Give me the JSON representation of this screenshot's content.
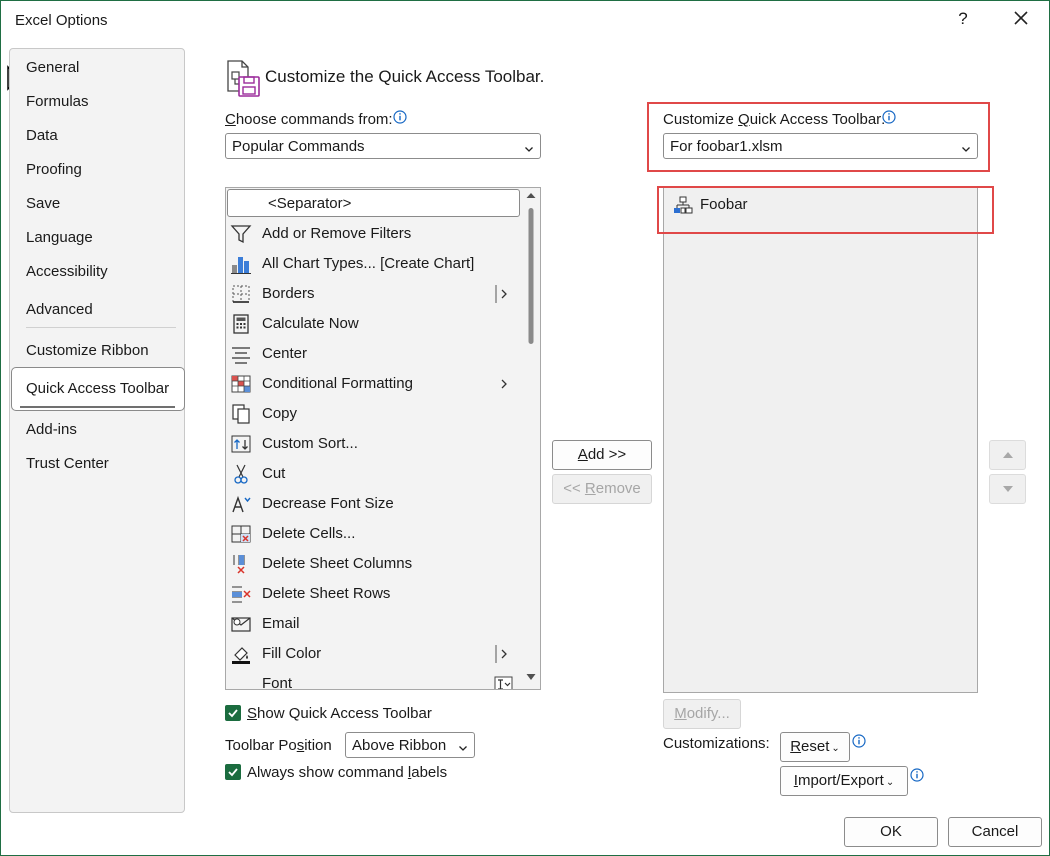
{
  "window": {
    "title": "Excel Options",
    "help_label": "?"
  },
  "sidebar": {
    "items": [
      {
        "label": "General"
      },
      {
        "label": "Formulas"
      },
      {
        "label": "Data"
      },
      {
        "label": "Proofing"
      },
      {
        "label": "Save"
      },
      {
        "label": "Language"
      },
      {
        "label": "Accessibility"
      },
      {
        "label": "Advanced"
      },
      {
        "label": "Customize Ribbon"
      },
      {
        "label": "Quick Access Toolbar"
      },
      {
        "label": "Add-ins"
      },
      {
        "label": "Trust Center"
      }
    ],
    "selected": "Quick Access Toolbar"
  },
  "header": {
    "title": "Customize the Quick Access Toolbar."
  },
  "choose_commands": {
    "label_mnemonic": "C",
    "label_rest": "hoose commands from:",
    "selected": "Popular Commands"
  },
  "commands": {
    "separator_label": "<Separator>",
    "items": [
      {
        "label": "Add or Remove Filters",
        "icon": "filter-icon"
      },
      {
        "label": "All Chart Types... [Create Chart]",
        "icon": "chart-icon"
      },
      {
        "label": "Borders",
        "icon": "borders-icon",
        "submenu": "split"
      },
      {
        "label": "Calculate Now",
        "icon": "calculator-icon"
      },
      {
        "label": "Center",
        "icon": "center-align-icon"
      },
      {
        "label": "Conditional Formatting",
        "icon": "conditional-formatting-icon",
        "submenu": "arrow"
      },
      {
        "label": "Copy",
        "icon": "copy-icon"
      },
      {
        "label": "Custom Sort...",
        "icon": "sort-icon"
      },
      {
        "label": "Cut",
        "icon": "scissors-icon"
      },
      {
        "label": "Decrease Font Size",
        "icon": "decrease-font-icon"
      },
      {
        "label": "Delete Cells...",
        "icon": "delete-cells-icon"
      },
      {
        "label": "Delete Sheet Columns",
        "icon": "delete-columns-icon"
      },
      {
        "label": "Delete Sheet Rows",
        "icon": "delete-rows-icon"
      },
      {
        "label": "Email",
        "icon": "email-icon"
      },
      {
        "label": "Fill Color",
        "icon": "fill-color-icon",
        "submenu": "split"
      },
      {
        "label": "Font",
        "icon": "font-icon",
        "submenu": "combo"
      }
    ]
  },
  "show_qat": {
    "mnemonic": "S",
    "rest": "how Quick Access Toolbar",
    "checked": true
  },
  "toolbar_position": {
    "label_pre": "Toolbar Po",
    "label_mnemonic": "s",
    "label_post": "ition",
    "selected": "Above Ribbon"
  },
  "always_show_labels": {
    "pre": "Always show command ",
    "mnemonic": "l",
    "post": "abels",
    "checked": true
  },
  "buttons": {
    "add_mnemonic": "A",
    "add_rest": "dd >>",
    "remove_pre": "<< ",
    "remove_mnemonic": "R",
    "remove_rest": "emove",
    "modify_mnemonic": "M",
    "modify_rest": "odify...",
    "reset_mnemonic": "R",
    "reset_rest": "eset",
    "import_mnemonic": "I",
    "import_rest": "mport/Export",
    "ok": "OK",
    "cancel": "Cancel"
  },
  "customize_qat": {
    "label_pre": "Customize ",
    "label_mnemonic": "Q",
    "label_post": "uick Access Toolbar:",
    "selected": "For foobar1.xlsm",
    "items": [
      {
        "label": "Foobar",
        "icon": "macro-flowchart-icon"
      }
    ]
  },
  "customizations": {
    "label": "Customizations:"
  },
  "colors": {
    "accent_green": "#1b6c3f",
    "highlight_red": "#e04848",
    "window_border": "#1f6e43"
  }
}
